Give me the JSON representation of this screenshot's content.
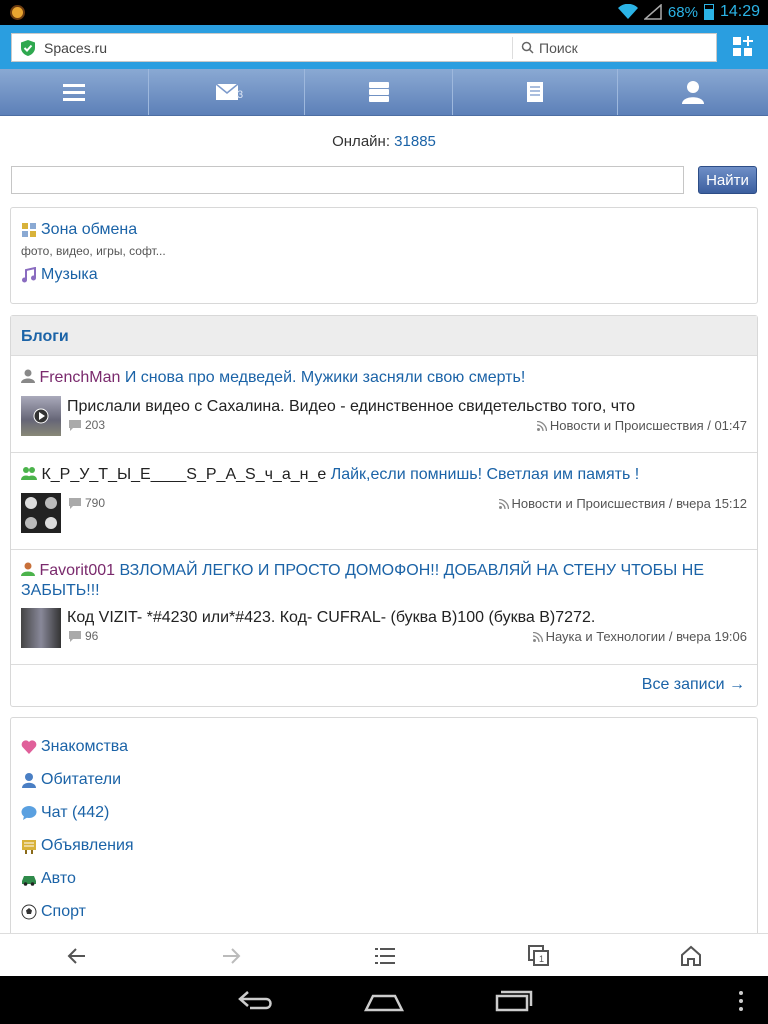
{
  "status": {
    "battery": "68%",
    "time": "14:29"
  },
  "browser": {
    "url": "Spaces.ru",
    "search_placeholder": "Поиск"
  },
  "nav": {
    "mail_count": "3"
  },
  "online": {
    "label": "Онлайн:",
    "count": "31885"
  },
  "search": {
    "button": "Найти"
  },
  "exchange": {
    "title": "Зона обмена",
    "subtitle": "фото, видео, игры, софт...",
    "music": "Музыка"
  },
  "blogs": {
    "heading": "Блоги",
    "entries": [
      {
        "author": "FrenchMan",
        "title": "И снова про медведей. Мужики засняли свою смерть!",
        "snippet": "Прислали видео с Сахалина. Видео - единственное свидетельство того, что",
        "comments": "203",
        "meta": "Новости и Происшествия / 01:47"
      },
      {
        "author": "К_Р_У_Т_Ы_Е____S_P_A_S_ч_а_н_е",
        "title": "Лайк,если помнишь! Светлая им память !",
        "snippet": "",
        "comments": "790",
        "meta": "Новости и Происшествия / вчера 15:12"
      },
      {
        "author": "Favorit001",
        "title": "ВЗЛОМАЙ ЛЕГКО И ПРОСТО ДОМОФОН!! ДОБАВЛЯЙ НА СТЕНУ ЧТОБЫ НЕ ЗАБЫТЬ!!!",
        "snippet": "Код VIZIT- *#4230 или*#423. Код- CUFRAL- (буква В)100 (буква В)7272.",
        "comments": "96",
        "meta": "Наука и Технологии / вчера 19:06"
      }
    ],
    "all_link": "Все записи →"
  },
  "sections": [
    {
      "label": "Знакомства",
      "icon": "heart-icon",
      "color": "#e0609a"
    },
    {
      "label": "Обитатели",
      "icon": "user-icon",
      "color": "#4a7fc4"
    },
    {
      "label": "Чат (442)",
      "icon": "chat-icon",
      "color": "#5aa0e0"
    },
    {
      "label": "Объявления",
      "icon": "board-icon",
      "color": "#d8b23a"
    },
    {
      "label": "Авто",
      "icon": "car-icon",
      "color": "#2f8a4a"
    },
    {
      "label": "Спорт",
      "icon": "ball-icon",
      "color": "#333333"
    }
  ]
}
